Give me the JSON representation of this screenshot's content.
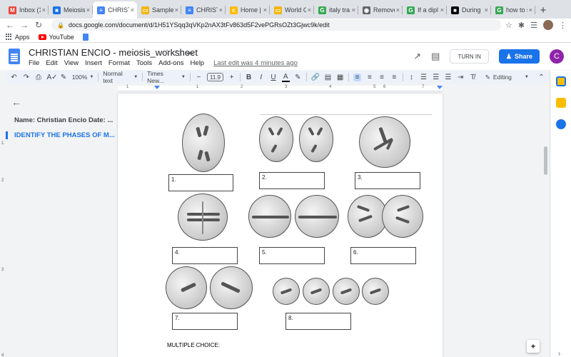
{
  "browser": {
    "tabs": [
      {
        "label": "Inbox (1…",
        "icon": "gmail-icon",
        "color": "#ea4335",
        "glyph": "M"
      },
      {
        "label": "Meiosis…",
        "icon": "docs-blue-icon",
        "color": "#1a73e8",
        "glyph": "■"
      },
      {
        "label": "CHRISTI…",
        "icon": "docs-icon",
        "color": "#4285f4",
        "glyph": "≡",
        "active": true
      },
      {
        "label": "Sample…",
        "icon": "slides-icon",
        "color": "#f4b400",
        "glyph": "▭"
      },
      {
        "label": "CHRISTI…",
        "icon": "docs-icon",
        "color": "#4285f4",
        "glyph": "≡"
      },
      {
        "label": "Home | …",
        "icon": "home-site-icon",
        "color": "#fbbc04",
        "glyph": "c"
      },
      {
        "label": "World G…",
        "icon": "slides-icon",
        "color": "#f4b400",
        "glyph": "▭"
      },
      {
        "label": "italy tra…",
        "icon": "google-icon",
        "color": "#34a853",
        "glyph": "G"
      },
      {
        "label": "Remove…",
        "icon": "eye-icon",
        "color": "#5f6368",
        "glyph": "◉"
      },
      {
        "label": "If a dipl…",
        "icon": "google-icon",
        "color": "#34a853",
        "glyph": "G"
      },
      {
        "label": "During …",
        "icon": "brainly-icon",
        "color": "#000000",
        "glyph": "■"
      },
      {
        "label": "how to s…",
        "icon": "google-icon",
        "color": "#34a853",
        "glyph": "G"
      }
    ],
    "url": "docs.google.com/document/d/1H51YSqq3qVKp2nAX3tFv863d5F2vePGRsOZt3Gjwc9k/edit",
    "bookmarks": [
      {
        "label": "Apps",
        "icon": "apps-grid-icon"
      },
      {
        "label": "YouTube",
        "icon": "youtube-icon"
      },
      {
        "label": "",
        "icon": "docs-bookmark-icon"
      }
    ]
  },
  "docs": {
    "title": "CHRISTIAN ENCIO - meiosis_worksheet",
    "menu": [
      "File",
      "Edit",
      "View",
      "Insert",
      "Format",
      "Tools",
      "Add-ons",
      "Help"
    ],
    "last_edit": "Last edit was 4 minutes ago",
    "turn_in": "TURN IN",
    "share": "Share",
    "user_initial": "C",
    "toolbar": {
      "zoom": "100%",
      "style": "Normal text",
      "font": "Times New...",
      "font_size": "11.9",
      "mode": "Editing"
    },
    "ruler_numbers": [
      "1",
      "1",
      "2",
      "3",
      "4",
      "5",
      "6",
      "7"
    ],
    "vruler_numbers": [
      "1",
      "2",
      "3",
      "4"
    ],
    "outline": {
      "item1": "Name: Christian Encio Date: ...",
      "item2": "IDENTIFY THE PHASES OF M..."
    },
    "answer_boxes": [
      "1.",
      "2.",
      "3.",
      "4.",
      "5.",
      "6.",
      "7.",
      "8."
    ],
    "multiple_choice": "MULTIPLE CHOICE:"
  },
  "colors": {
    "accent": "#1a73e8",
    "user_avatar": "#8e24aa"
  }
}
